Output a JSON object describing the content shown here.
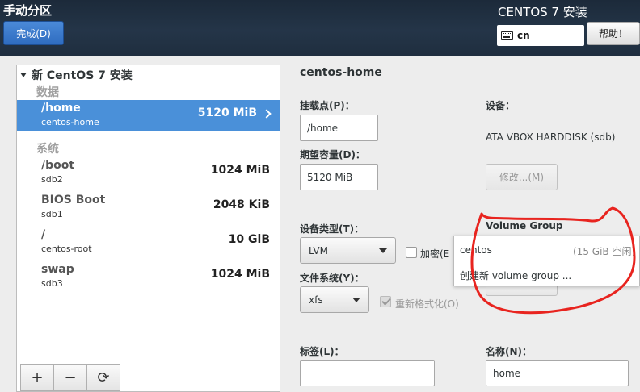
{
  "header": {
    "title": "手动分区",
    "done_label": "完成(D)",
    "product_title": "CENTOS 7 安装",
    "keyboard_layout": "cn",
    "help_label": "帮助！"
  },
  "tree": {
    "root_label": "新 CentOS 7 安装",
    "group_data_label": "数据",
    "group_system_label": "系统",
    "data_items": [
      {
        "name": "/home",
        "device": "centos-home",
        "size": "5120 MiB"
      }
    ],
    "system_items": [
      {
        "name": "/boot",
        "device": "sdb2",
        "size": "1024 MiB"
      },
      {
        "name": "BIOS Boot",
        "device": "sdb1",
        "size": "2048 KiB"
      },
      {
        "name": "/",
        "device": "centos-root",
        "size": "10 GiB"
      },
      {
        "name": "swap",
        "device": "sdb3",
        "size": "1024 MiB"
      }
    ],
    "toolbar": {
      "add": "+",
      "remove": "−",
      "refresh": "⟳"
    }
  },
  "details": {
    "title": "centos-home",
    "mount_point_label": "挂载点(P)：",
    "mount_point_value": "/home",
    "capacity_label": "期望容量(D)：",
    "capacity_value": "5120 MiB",
    "device_label": "设备：",
    "device_value": "ATA VBOX HARDDISK (sdb)",
    "modify_label": "修改...(M)",
    "device_type_label": "设备类型(T)：",
    "device_type_value": "LVM",
    "encrypt_label": "加密(E",
    "volume_group_label": "Volume Group",
    "filesystem_label": "文件系统(Y)：",
    "filesystem_value": "xfs",
    "reformat_label": "重新格式化(O)",
    "tag_label": "标签(L)：",
    "tag_value": "",
    "name_label": "名称(N)：",
    "name_value": "home"
  },
  "vg_popup": {
    "option_existing": "centos",
    "option_existing_free": "(15 GiB 空闲)",
    "option_new": "创建新 volume group ..."
  },
  "colors": {
    "header_bg": "#1f2e3f",
    "selection": "#4a90d9",
    "annotation": "#e8241f"
  }
}
